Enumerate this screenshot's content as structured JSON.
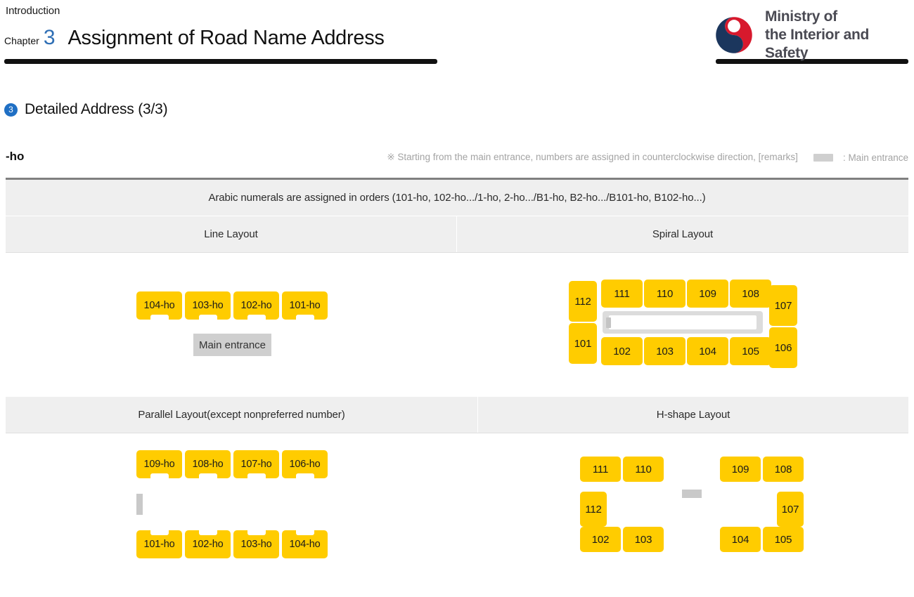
{
  "header": {
    "intro": "Introduction",
    "chapter_word": "Chapter",
    "chapter_number": "3",
    "title": "Assignment of Road Name Address",
    "logo_line1": "Ministry of",
    "logo_line2": "the Interior and Safety",
    "logo_icon": "taegeuk-swirl-icon",
    "colors": {
      "accent_blue": "#2f6fb5",
      "logo_red": "#d7192d",
      "logo_navy": "#1b365d",
      "rule": "#111111"
    }
  },
  "section": {
    "badge": "3",
    "title": "Detailed Address (3/3)",
    "badge_color": "#1f6fc4"
  },
  "note": {
    "left_label": "-ho",
    "text": "※ Starting from the main entrance, numbers are assigned in counterclockwise direction, [remarks]",
    "legend_swatch": "gray-swatch-icon",
    "legend_label": ": Main entrance"
  },
  "table": {
    "rule_text": "Arabic numerals are assigned in orders (101-ho, 102-ho.../1-ho, 2-ho.../B1-ho, B2-ho.../B101-ho, B102-ho...)",
    "headers_row1": [
      "Line Layout",
      "Spiral Layout"
    ],
    "headers_row2": [
      "Parallel Layout(except nonpreferred number)",
      "H-shape Layout"
    ],
    "colors": {
      "header_bg": "#efefef",
      "top_border": "#808080",
      "room": "#FFCC00",
      "entrance": "#cfcfcf"
    }
  },
  "diagrams": {
    "line_layout": {
      "name": "Line Layout",
      "rooms": [
        "104-ho",
        "103-ho",
        "102-ho",
        "101-ho"
      ],
      "entrance_label": "Main entrance"
    },
    "spiral_layout": {
      "name": "Spiral Layout",
      "left_tall": [
        "112",
        "101"
      ],
      "top_row": [
        "111",
        "110",
        "109",
        "108"
      ],
      "bottom_row": [
        "102",
        "103",
        "104",
        "105"
      ],
      "right_tall": [
        "107",
        "106"
      ],
      "corridor": "corridor-ring",
      "corridor_door": "main-entrance-mark"
    },
    "parallel_layout": {
      "name": "Parallel Layout(except nonpreferred number)",
      "top_row": [
        "109-ho",
        "108-ho",
        "107-ho",
        "106-ho"
      ],
      "bottom_row": [
        "101-ho",
        "102-ho",
        "103-ho",
        "104-ho"
      ],
      "entrance_mark": "main-entrance-bar"
    },
    "h_shape_layout": {
      "name": "H-shape Layout",
      "left_top": [
        "111",
        "110"
      ],
      "left_side": "112",
      "left_bottom": [
        "102",
        "103"
      ],
      "right_top": [
        "109",
        "108"
      ],
      "right_side": "107",
      "right_bottom": [
        "104",
        "105"
      ],
      "entrance_mark": "main-entrance-bar"
    }
  }
}
